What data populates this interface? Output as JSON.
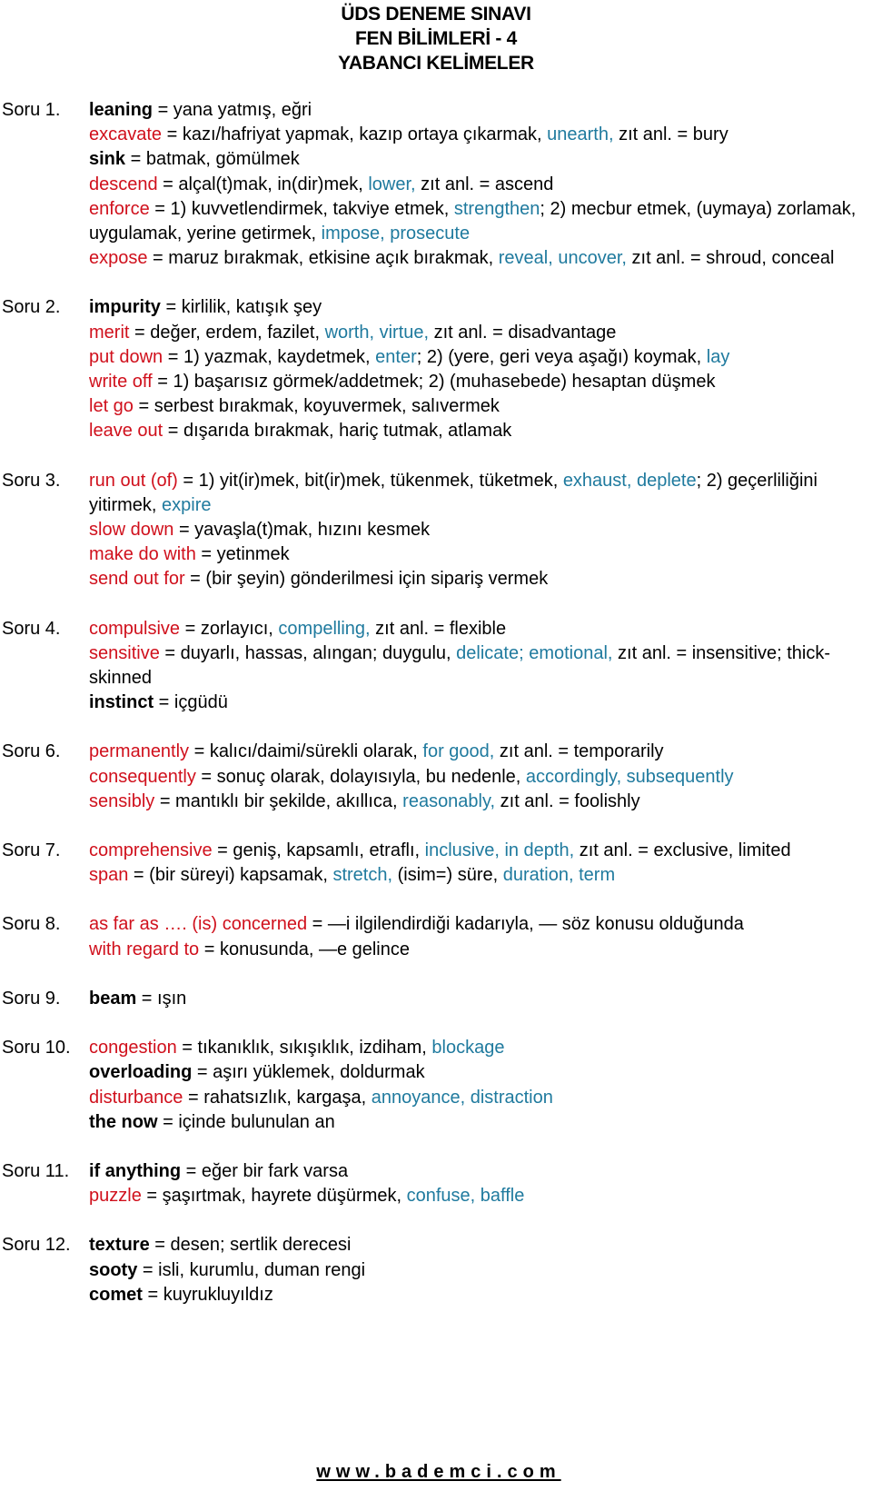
{
  "header": {
    "line1": "ÜDS DENEME SINAVI",
    "line2": "FEN BİLİMLERİ - 4",
    "line3": "YABANCI KELİMELER"
  },
  "colors": {
    "term_red": "#d0101c",
    "synonym_blue": "#1f7a9e",
    "text_black": "#000000"
  },
  "sections": [
    {
      "label": "Soru 1.",
      "entries": [
        [
          {
            "t": "leaning",
            "s": "bold"
          },
          {
            "t": " = yana yatmış, eğri",
            "s": "plain"
          }
        ],
        [
          {
            "t": "excavate",
            "s": "red"
          },
          {
            "t": " = kazı/hafriyat yapmak, kazıp ortaya çıkarmak, ",
            "s": "plain"
          },
          {
            "t": "unearth,",
            "s": "blue"
          },
          {
            "t": " zıt anl. = bury",
            "s": "plain"
          }
        ],
        [
          {
            "t": "sink",
            "s": "bold"
          },
          {
            "t": " = batmak, gömülmek",
            "s": "plain"
          }
        ],
        [
          {
            "t": "descend",
            "s": "red"
          },
          {
            "t": " = alçal(t)mak, in(dir)mek, ",
            "s": "plain"
          },
          {
            "t": "lower,",
            "s": "blue"
          },
          {
            "t": " zıt anl. = ascend",
            "s": "plain"
          }
        ],
        [
          {
            "t": "enforce",
            "s": "red"
          },
          {
            "t": " = 1) kuvvetlendirmek, takviye etmek, ",
            "s": "plain"
          },
          {
            "t": "strengthen",
            "s": "blue"
          },
          {
            "t": "; 2) mecbur etmek, (uymaya) zorlamak, uygulamak, yerine getirmek, ",
            "s": "plain"
          },
          {
            "t": "impose, prosecute",
            "s": "blue"
          }
        ],
        [
          {
            "t": "expose",
            "s": "red"
          },
          {
            "t": " = maruz bırakmak, etkisine açık bırakmak, ",
            "s": "plain"
          },
          {
            "t": "reveal, uncover,",
            "s": "blue"
          },
          {
            "t": " zıt anl. = shroud, conceal",
            "s": "plain"
          }
        ]
      ]
    },
    {
      "label": "Soru 2.",
      "entries": [
        [
          {
            "t": "impurity",
            "s": "bold"
          },
          {
            "t": " = kirlilik, katışık şey",
            "s": "plain"
          }
        ],
        [
          {
            "t": "merit",
            "s": "red"
          },
          {
            "t": " = değer, erdem, fazilet, ",
            "s": "plain"
          },
          {
            "t": "worth, virtue,",
            "s": "blue"
          },
          {
            "t": " zıt anl. = disadvantage",
            "s": "plain"
          }
        ],
        [
          {
            "t": "put down",
            "s": "red"
          },
          {
            "t": " = 1) yazmak, kaydetmek, ",
            "s": "plain"
          },
          {
            "t": "enter",
            "s": "blue"
          },
          {
            "t": "; 2) (yere, geri veya aşağı) koymak, ",
            "s": "plain"
          },
          {
            "t": "lay",
            "s": "blue"
          }
        ],
        [
          {
            "t": "write off",
            "s": "red"
          },
          {
            "t": " = 1) başarısız görmek/addetmek; 2) (muhasebede) hesaptan düşmek",
            "s": "plain"
          }
        ],
        [
          {
            "t": "let go",
            "s": "red"
          },
          {
            "t": " = serbest bırakmak, koyuvermek, salıvermek",
            "s": "plain"
          }
        ],
        [
          {
            "t": "leave out",
            "s": "red"
          },
          {
            "t": " = dışarıda bırakmak, hariç tutmak, atlamak",
            "s": "plain"
          }
        ]
      ]
    },
    {
      "label": "Soru 3.",
      "entries": [
        [
          {
            "t": "run out (of)",
            "s": "red"
          },
          {
            "t": " = 1) yit(ir)mek, bit(ir)mek, tükenmek, tüketmek, ",
            "s": "plain"
          },
          {
            "t": "exhaust, deplete",
            "s": "blue"
          },
          {
            "t": "; 2) geçerliliğini yitirmek, ",
            "s": "plain"
          },
          {
            "t": "expire",
            "s": "blue"
          }
        ],
        [
          {
            "t": "slow down",
            "s": "red"
          },
          {
            "t": " = yavaşla(t)mak, hızını kesmek",
            "s": "plain"
          }
        ],
        [
          {
            "t": "make do with",
            "s": "red"
          },
          {
            "t": " = yetinmek",
            "s": "plain"
          }
        ],
        [
          {
            "t": "send out for",
            "s": "red"
          },
          {
            "t": " = (bir şeyin) gönderilmesi için sipariş vermek",
            "s": "plain"
          }
        ]
      ]
    },
    {
      "label": "Soru 4.",
      "entries": [
        [
          {
            "t": "compulsive",
            "s": "red"
          },
          {
            "t": " = zorlayıcı, ",
            "s": "plain"
          },
          {
            "t": "compelling,",
            "s": "blue"
          },
          {
            "t": " zıt anl. = flexible",
            "s": "plain"
          }
        ],
        [
          {
            "t": "sensitive",
            "s": "red"
          },
          {
            "t": " = duyarlı, hassas, alıngan; duygulu, ",
            "s": "plain"
          },
          {
            "t": "delicate; emotional,",
            "s": "blue"
          },
          {
            "t": " zıt anl. = insensitive; thick-skinned",
            "s": "plain"
          }
        ],
        [
          {
            "t": "instinct",
            "s": "bold"
          },
          {
            "t": " = içgüdü",
            "s": "plain"
          }
        ]
      ]
    },
    {
      "label": "Soru 6.",
      "entries": [
        [
          {
            "t": "permanently",
            "s": "red"
          },
          {
            "t": " = kalıcı/daimi/sürekli olarak, ",
            "s": "plain"
          },
          {
            "t": "for good,",
            "s": "blue"
          },
          {
            "t": " zıt anl. = temporarily",
            "s": "plain"
          }
        ],
        [
          {
            "t": "consequently",
            "s": "red"
          },
          {
            "t": " = sonuç olarak, dolayısıyla, bu nedenle, ",
            "s": "plain"
          },
          {
            "t": "accordingly, subsequently",
            "s": "blue"
          }
        ],
        [
          {
            "t": "sensibly",
            "s": "red"
          },
          {
            "t": " = mantıklı bir şekilde, akıllıca, ",
            "s": "plain"
          },
          {
            "t": "reasonably,",
            "s": "blue"
          },
          {
            "t": " zıt anl. = foolishly",
            "s": "plain"
          }
        ]
      ]
    },
    {
      "label": "Soru 7.",
      "entries": [
        [
          {
            "t": "comprehensive",
            "s": "red"
          },
          {
            "t": " = geniş, kapsamlı, etraflı, ",
            "s": "plain"
          },
          {
            "t": "inclusive, in depth,",
            "s": "blue"
          },
          {
            "t": " zıt anl. = exclusive, limited",
            "s": "plain"
          }
        ],
        [
          {
            "t": "span",
            "s": "red"
          },
          {
            "t": " = (bir süreyi) kapsamak, ",
            "s": "plain"
          },
          {
            "t": "stretch,",
            "s": "blue"
          },
          {
            "t": " (isim=) süre, ",
            "s": "plain"
          },
          {
            "t": "duration, term",
            "s": "blue"
          }
        ]
      ]
    },
    {
      "label": "Soru 8.",
      "entries": [
        [
          {
            "t": "as far as …. (is) concerned",
            "s": "red"
          },
          {
            "t": " = —i ilgilendirdiği kadarıyla, — söz konusu olduğunda",
            "s": "plain"
          }
        ],
        [
          {
            "t": "with regard to",
            "s": "red"
          },
          {
            "t": " = konusunda, —e gelince",
            "s": "plain"
          }
        ]
      ]
    },
    {
      "label": "Soru 9.",
      "entries": [
        [
          {
            "t": "beam",
            "s": "bold"
          },
          {
            "t": " = ışın",
            "s": "plain"
          }
        ]
      ]
    },
    {
      "label": "Soru 10.",
      "entries": [
        [
          {
            "t": "congestion",
            "s": "red"
          },
          {
            "t": " = tıkanıklık, sıkışıklık, izdiham, ",
            "s": "plain"
          },
          {
            "t": "blockage",
            "s": "blue"
          }
        ],
        [
          {
            "t": "overloading",
            "s": "bold"
          },
          {
            "t": " = aşırı yüklemek, doldurmak",
            "s": "plain"
          }
        ],
        [
          {
            "t": "disturbance",
            "s": "red"
          },
          {
            "t": " = rahatsızlık, kargaşa, ",
            "s": "plain"
          },
          {
            "t": "annoyance, distraction",
            "s": "blue"
          }
        ],
        [
          {
            "t": "the now",
            "s": "bold"
          },
          {
            "t": " = içinde bulunulan an",
            "s": "plain"
          }
        ]
      ]
    },
    {
      "label": "Soru 11.",
      "entries": [
        [
          {
            "t": "if anything",
            "s": "bold"
          },
          {
            "t": " = eğer bir fark varsa",
            "s": "plain"
          }
        ],
        [
          {
            "t": "puzzle",
            "s": "red"
          },
          {
            "t": " = şaşırtmak, hayrete düşürmek, ",
            "s": "plain"
          },
          {
            "t": "confuse, baffle",
            "s": "blue"
          }
        ]
      ]
    },
    {
      "label": "Soru 12.",
      "entries": [
        [
          {
            "t": "texture",
            "s": "bold"
          },
          {
            "t": " = desen; sertlik derecesi",
            "s": "plain"
          }
        ],
        [
          {
            "t": "sooty",
            "s": "bold"
          },
          {
            "t": " = isli, kurumlu, duman rengi",
            "s": "plain"
          }
        ],
        [
          {
            "t": "comet",
            "s": "bold"
          },
          {
            "t": " = kuyrukluyıldız",
            "s": "plain"
          }
        ]
      ]
    }
  ],
  "footer": {
    "website": "www.bademci.com"
  }
}
